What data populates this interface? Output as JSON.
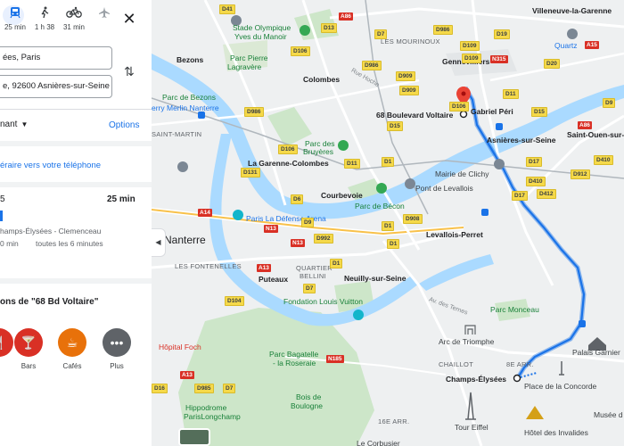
{
  "travel_modes": [
    {
      "icon": "transit-icon",
      "time": "25 min",
      "active": true
    },
    {
      "icon": "walk-icon",
      "time": "1 h 38",
      "active": false
    },
    {
      "icon": "bike-icon",
      "time": "31 min",
      "active": false
    },
    {
      "icon": "flight-icon",
      "time": "",
      "active": false
    }
  ],
  "inputs": {
    "origin": "ées, Paris",
    "destination": "e, 92600 Asnières-sur-Seine"
  },
  "depart": {
    "label": "nant"
  },
  "options_label": "Options",
  "send_to_phone": "éraire vers votre téléphone",
  "route": {
    "number": "5",
    "time": "25 min",
    "stop": "hamps-Élysées - Clemenceau",
    "freq_prefix": "0 min",
    "frequency": "toutes les 6 minutes"
  },
  "nearby": {
    "title": "ons de \"68 Bd Voltaire\"",
    "categories": [
      {
        "label": "",
        "icon": "restaurant-icon",
        "color": "#d93025"
      },
      {
        "label": "Bars",
        "icon": "bar-icon",
        "color": "#d93025"
      },
      {
        "label": "Cafés",
        "icon": "cafe-icon",
        "color": "#e8710a"
      },
      {
        "label": "Plus",
        "icon": "more-icon",
        "color": "#5f6368"
      }
    ]
  },
  "map": {
    "places": {
      "villeneuve": "Villeneuve-la-Garenne",
      "stade": "Stade Olympique",
      "stade2": "Yves du Manoir",
      "mourinoux": "LES MOURINOUX",
      "gennevilliers": "Gennevilliers",
      "quartz": "Quartz",
      "bezons": "Bezons",
      "parcpierre": "Parc Pierre",
      "parcpierre2": "Lagravère",
      "colombes": "Colombes",
      "ruehoche": "Rue Hoche",
      "parcbezons": "Parc de Bezons",
      "voltaire": "68 Boulevard Voltaire",
      "gabriel": "Gabriel Péri",
      "merlin": "erry Merlin Nanterre",
      "saintmartin": "SAINT-MARTIN",
      "parcbruyeres": "Parc des",
      "parcbruyeres2": "Bruyères",
      "asnieres": "Asnières-sur-Seine",
      "saintouen": "Saint-Ouen-sur-",
      "garenne": "La Garenne-Colombes",
      "courbevoie": "Courbevoie",
      "mairie": "Mairie de Clichy",
      "pontlevallois": "Pont de Levallois",
      "parcbecon": "Parc de Bécon",
      "ladefense": "Paris La Défense Arena",
      "levallois": "Levallois-Perret",
      "nanterre": "Nanterre",
      "fontenelles": "LES FONTENELLES",
      "puteaux": "Puteaux",
      "quartier": "QUARTIER",
      "quartier2": "BELLINI",
      "neuilly": "Neuilly-sur-Seine",
      "vuitton": "Fondation Louis Vuitton",
      "ternes": "Av. des Ternes",
      "monceau": "Parc Monceau",
      "hopital": "Hôpital Foch",
      "arc": "Arc de Triomphe",
      "palais": "Palais Garnier",
      "bagatelle": "Parc Bagatelle",
      "bagatelle2": "- la Roseraie",
      "chaillot": "CHAILLOT",
      "arr8": "8E ARR.",
      "champs": "Champs-Élysées",
      "concorde": "Place de la Concorde",
      "bois": "Bois de",
      "bois2": "Boulogne",
      "hippodrome": "Hippodrome",
      "hippodrome2": "ParisLongchamp",
      "arr16": "16E ARR.",
      "tour": "Tour Eiffel",
      "invalides": "Hôtel des Invalides",
      "musee": "Musée d",
      "corbusier": "Le Corbusier",
      "collapse_label": "◀"
    },
    "badges": [
      "D41",
      "A86",
      "D13",
      "D986",
      "D19",
      "D7",
      "D109",
      "D20",
      "D109",
      "A15",
      "D106",
      "D986",
      "D909",
      "N315",
      "D986",
      "D909",
      "D11",
      "D410",
      "D9",
      "D15",
      "D106",
      "D17",
      "D15",
      "A86",
      "D131",
      "D11",
      "D410",
      "D412",
      "D1",
      "D912",
      "D106",
      "D6",
      "D908",
      "D17",
      "A14",
      "D9",
      "D1",
      "N13",
      "D992",
      "N13",
      "D1",
      "D104",
      "A13",
      "D7",
      "D1",
      "N185",
      "D985",
      "D7",
      "A13",
      "D16"
    ]
  }
}
